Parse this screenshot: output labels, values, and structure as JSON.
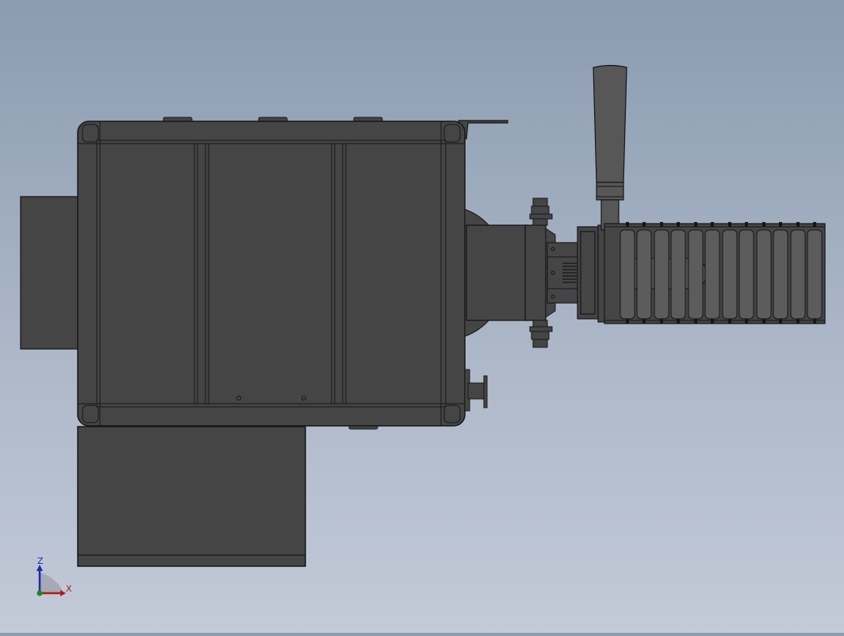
{
  "colors": {
    "background_top": "#8b9bb0",
    "background_bottom": "#c3cad8",
    "body_fill": "#454545",
    "edge": "#161616",
    "handle_fill": "#575757",
    "roller_fill": "#5c5c5c",
    "axis_z": "#1a2ab0",
    "axis_x": "#b01a1a",
    "axis_y": "#1a8a1a"
  },
  "triad": {
    "z_label": "Z",
    "x_label": "X"
  }
}
